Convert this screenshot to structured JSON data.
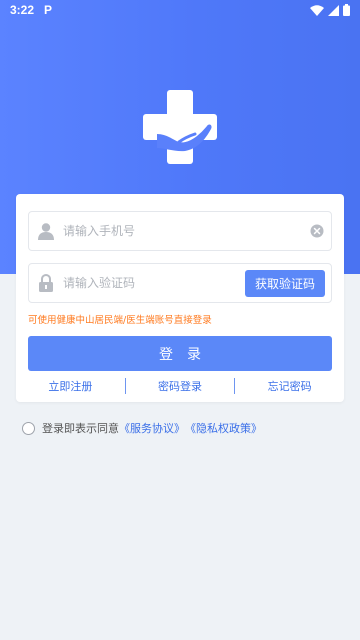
{
  "status_bar": {
    "time": "3:22",
    "app_icon": "P",
    "icons": [
      "wifi-icon",
      "signal-icon",
      "battery-icon"
    ]
  },
  "colors": {
    "brand": "#4f78f9",
    "button": "#5b88f8",
    "link": "#3a6fe8",
    "hint": "#ff7a1f",
    "background": "#eef2f6"
  },
  "logo": {
    "icon": "medical-cross-hand-icon"
  },
  "form": {
    "phone_placeholder": "请输入手机号",
    "code_placeholder": "请输入验证码",
    "get_code_label": "获取验证码",
    "hint": "可使用健康中山居民端/医生端账号直接登录",
    "login_label": "登录"
  },
  "links": {
    "register": "立即注册",
    "password_login": "密码登录",
    "forgot_password": "忘记密码"
  },
  "agreement": {
    "prefix": "登录即表示同意",
    "service": "《服务协议》",
    "privacy": "《隐私权政策》"
  }
}
